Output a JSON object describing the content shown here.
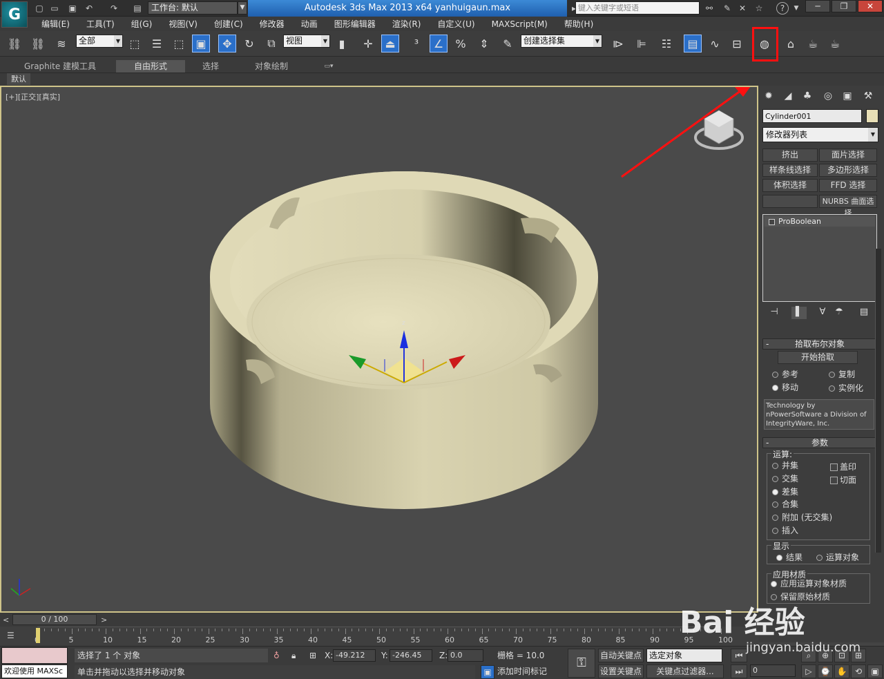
{
  "app": {
    "title": "Autodesk 3ds Max  2013 x64      yanhuigaun.max",
    "workspace": "工作台: 默认",
    "search_placeholder": "键入关键字或短语",
    "help": "?"
  },
  "menu": [
    "编辑(E)",
    "工具(T)",
    "组(G)",
    "视图(V)",
    "创建(C)",
    "修改器",
    "动画",
    "图形编辑器",
    "渲染(R)",
    "自定义(U)",
    "MAXScript(M)",
    "帮助(H)"
  ],
  "toolbar": {
    "selection_filter": "全部",
    "ref_coord": "视图",
    "named_selection": "创建选择集"
  },
  "ribbon": {
    "tabs": [
      "Graphite 建模工具",
      "自由形式",
      "选择",
      "对象绘制"
    ],
    "sub": "默认"
  },
  "viewport": {
    "label_plus": "[+]",
    "label_view": "[正交]",
    "label_shade": "[真实]"
  },
  "command_panel": {
    "object_name": "Cylinder001",
    "modifier_list": "修改器列表",
    "modifier_buttons": [
      "挤出",
      "面片选择",
      "样条线选择",
      "多边形选择",
      "体积选择",
      "FFD 选择",
      "",
      "NURBS 曲面选择"
    ],
    "stack_item": "ProBoolean",
    "pick_rollout": "拾取布尔对象",
    "start_pick": "开始拾取",
    "pick_options": [
      "参考",
      "复制",
      "移动",
      "实例化"
    ],
    "tech_text": "Technology by nPowerSoftware a Division of IntegrityWare, Inc.",
    "params_rollout": "参数",
    "ops_label": "运算:",
    "ops": [
      "并集",
      "交集",
      "差集",
      "合集",
      "附加 (无交集)",
      "插入"
    ],
    "ops_checks": [
      "盖印",
      "切面"
    ],
    "display_label": "显示",
    "display_opts": [
      "结果",
      "运算对象"
    ],
    "material_label": "应用材质",
    "material_opts": [
      "应用运算对象材质",
      "保留原始材质"
    ]
  },
  "timeline": {
    "slider": "0 / 100",
    "ticks": [
      "0",
      "5",
      "10",
      "15",
      "20",
      "25",
      "30",
      "35",
      "40",
      "45",
      "50",
      "55",
      "60",
      "65",
      "70",
      "75",
      "80",
      "85",
      "90",
      "95",
      "100"
    ]
  },
  "status": {
    "maxscript": "欢迎使用 MAXSc",
    "selected": "选择了 1 个 对象",
    "prompt": "单击并拖动以选择并移动对象",
    "x_label": "X:",
    "x": "-49.212",
    "y_label": "Y:",
    "y": "-246.45",
    "z_label": "Z:",
    "z": "0.0",
    "grid": "栅格 = 10.0",
    "auto_key": "自动关键点",
    "set_key": "设置关键点",
    "sel_object": "选定对象",
    "key_filters": "关键点过滤器...",
    "add_time_tag": "添加时间标记",
    "frame": "0"
  },
  "watermark": {
    "logo": "Bai 经验",
    "url": "jingyan.baidu.com"
  },
  "colors": {
    "highlight": "#ff1010",
    "title_blue": "#2f6fc0",
    "object": "#dcd6b0"
  }
}
